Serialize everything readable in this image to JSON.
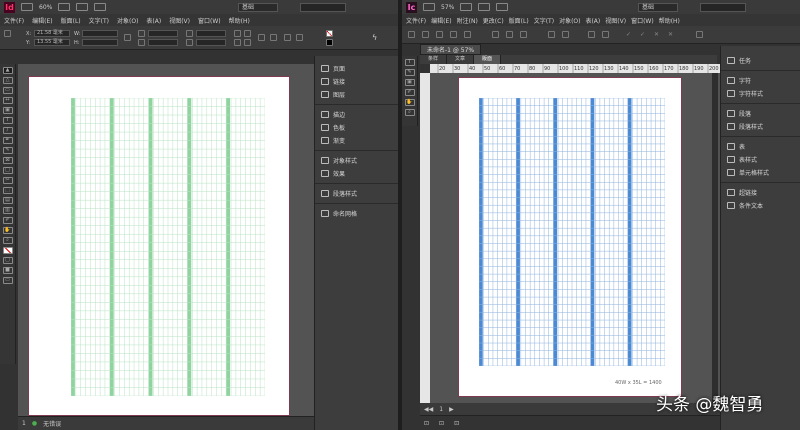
{
  "left": {
    "app_logo": "Id",
    "zoom": "60%",
    "workspace": "基础",
    "menu": [
      "文件(F)",
      "编辑(E)",
      "版面(L)",
      "文字(T)",
      "对象(O)",
      "表(A)",
      "视图(V)",
      "窗口(W)",
      "帮助(H)"
    ],
    "ctrl": {
      "x_label": "X:",
      "x_value": "21.58 毫米",
      "y_label": "Y:",
      "y_value": "13.55 毫米",
      "w_label": "W:",
      "h_label": "H:"
    },
    "panel_items": [
      {
        "icon": "pages-icon",
        "label": "页面"
      },
      {
        "icon": "links-icon",
        "label": "链接"
      },
      {
        "icon": "layers-icon",
        "label": "图层"
      },
      {
        "icon": "stroke-icon",
        "label": "描边"
      },
      {
        "icon": "swatches-icon",
        "label": "色板"
      },
      {
        "icon": "gradient-icon",
        "label": "渐变"
      },
      {
        "icon": "object-styles-icon",
        "label": "对象样式"
      },
      {
        "icon": "effects-icon",
        "label": "效果"
      },
      {
        "icon": "paragraph-styles-icon",
        "label": "段落样式"
      },
      {
        "icon": "named-grid-icon",
        "label": "命名网格"
      }
    ],
    "status": {
      "page": "1",
      "errors": "无错误"
    }
  },
  "right": {
    "app_logo": "Ic",
    "zoom": "57%",
    "workspace": "基础",
    "menu": [
      "文件(F)",
      "编辑(E)",
      "附注(N)",
      "更改(C)",
      "版面(L)",
      "文字(T)",
      "对象(O)",
      "表(A)",
      "视图(V)",
      "窗口(W)",
      "帮助(H)"
    ],
    "doc_tab": "未命名-1 @ 57%",
    "subtabs": [
      "条样",
      "文章",
      "版面"
    ],
    "ruler_ticks": [
      "20",
      "30",
      "40",
      "50",
      "60",
      "70",
      "80",
      "90",
      "100",
      "110",
      "120",
      "130",
      "140",
      "150",
      "160",
      "170",
      "180",
      "190",
      "200"
    ],
    "footnote": "40W x 35L = 1400",
    "panel_items": [
      {
        "icon": "assignments-icon",
        "label": "任务"
      },
      {
        "icon": "character-icon",
        "label": "字符"
      },
      {
        "icon": "character-styles-icon",
        "label": "字符样式"
      },
      {
        "icon": "paragraph-icon",
        "label": "段落"
      },
      {
        "icon": "paragraph-styles-icon",
        "label": "段落样式"
      },
      {
        "icon": "table-icon",
        "label": "表"
      },
      {
        "icon": "table-styles-icon",
        "label": "表样式"
      },
      {
        "icon": "cell-styles-icon",
        "label": "单元格样式"
      },
      {
        "icon": "hyperlinks-icon",
        "label": "超链接"
      },
      {
        "icon": "conditional-text-icon",
        "label": "条件文本"
      }
    ],
    "status": {
      "page": "1"
    }
  },
  "watermark": "头条 @魏智勇"
}
